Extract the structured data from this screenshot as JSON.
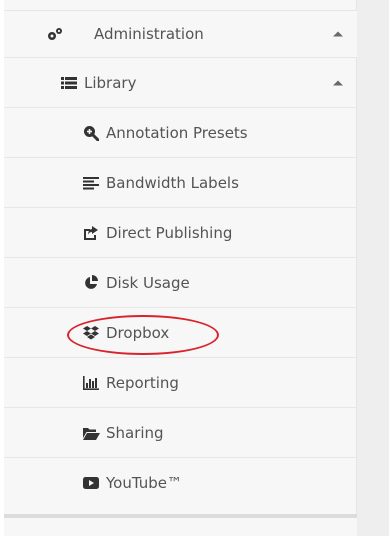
{
  "sidebar": {
    "admin": {
      "label": "Administration",
      "icon": "gears-icon"
    },
    "library": {
      "label": "Library",
      "icon": "list-icon"
    },
    "items": [
      {
        "label": "Annotation Presets",
        "icon": "search-plus-icon"
      },
      {
        "label": "Bandwidth Labels",
        "icon": "align-left-icon"
      },
      {
        "label": "Direct Publishing",
        "icon": "share-square-icon"
      },
      {
        "label": "Disk Usage",
        "icon": "pie-chart-icon"
      },
      {
        "label": "Dropbox",
        "icon": "dropbox-icon"
      },
      {
        "label": "Reporting",
        "icon": "bar-chart-icon"
      },
      {
        "label": "Sharing",
        "icon": "folder-open-icon"
      },
      {
        "label": "YouTube™",
        "icon": "youtube-play-icon"
      }
    ]
  },
  "colors": {
    "text": "#545454",
    "sidebar_bg": "#f7f7f7",
    "highlight": "#d9232c"
  }
}
